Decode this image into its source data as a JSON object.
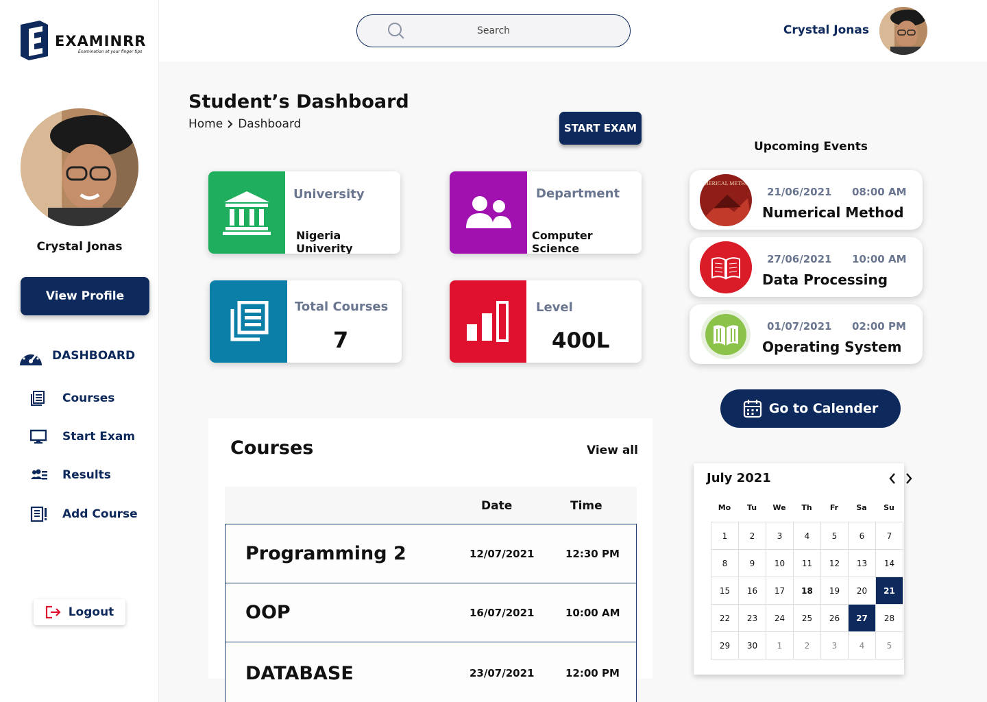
{
  "brand": {
    "name": "EXAMINRR",
    "tagline": "Examination at your finger tips"
  },
  "user": {
    "name": "Crystal Jonas"
  },
  "sidebar": {
    "view_profile": "View Profile",
    "items": [
      {
        "label": "DASHBOARD",
        "icon": "gauge-icon",
        "active": true
      },
      {
        "label": "Courses",
        "icon": "newspaper-icon"
      },
      {
        "label": "Start Exam",
        "icon": "monitor-icon"
      },
      {
        "label": "Results",
        "icon": "users-list-icon"
      },
      {
        "label": "Add Course",
        "icon": "document-add-icon"
      }
    ],
    "logout": "Logout"
  },
  "search": {
    "placeholder": "Search"
  },
  "header": {
    "title": "Student’s Dashboard",
    "breadcrumb": [
      "Home",
      "Dashboard"
    ],
    "start_exam": "START EXAM"
  },
  "cards": [
    {
      "label": "University",
      "value": "Nigeria Univerity",
      "color": "#1fae5e",
      "icon": "university-icon"
    },
    {
      "label": "Department",
      "value": "Computer Science",
      "color": "#a011b0",
      "icon": "users-icon"
    },
    {
      "label": "Total Courses",
      "value": "7",
      "color": "#0b7fa8",
      "icon": "newspaper-icon"
    },
    {
      "label": "Level",
      "value": "400L",
      "color": "#e0112f",
      "icon": "bar-chart-icon"
    }
  ],
  "courses": {
    "title": "Courses",
    "view_all": "View all",
    "columns": [
      "Date",
      "Time"
    ],
    "rows": [
      {
        "name": "Programming 2",
        "date": "12/07/2021",
        "time": "12:30 PM"
      },
      {
        "name": "OOP",
        "date": "16/07/2021",
        "time": "10:00 AM"
      },
      {
        "name": "DATABASE",
        "date": "23/07/2021",
        "time": "12:00 PM"
      }
    ]
  },
  "events": {
    "title": "Upcoming Events",
    "items": [
      {
        "date": "21/06/2021",
        "time": "08:00 AM",
        "name": "Numerical Method",
        "thumb_text": "NUMERICAL METHODS"
      },
      {
        "date": "27/06/2021",
        "time": "10:00 AM",
        "name": "Data Processing"
      },
      {
        "date": "01/07/2021",
        "time": "02:00 PM",
        "name": "Operating System"
      }
    ],
    "calendar_button": "Go to Calender"
  },
  "calendar": {
    "month": "July 2021",
    "weekdays": [
      "Mo",
      "Tu",
      "We",
      "Th",
      "Fr",
      "Sa",
      "Su"
    ],
    "days": [
      "1",
      "2",
      "3",
      "4",
      "5",
      "6",
      "7",
      "8",
      "9",
      "10",
      "11",
      "12",
      "13",
      "14",
      "15",
      "16",
      "17",
      "18",
      "19",
      "20",
      "21",
      "22",
      "23",
      "24",
      "25",
      "26",
      "27",
      "28",
      "29",
      "30",
      "1",
      "2",
      "3",
      "4",
      "5"
    ],
    "muted_from_index": 30,
    "bold_day": "18",
    "selected_days": [
      "21",
      "27"
    ]
  },
  "colors": {
    "primary": "#0e2a5c",
    "label_gray": "#6a7690"
  }
}
